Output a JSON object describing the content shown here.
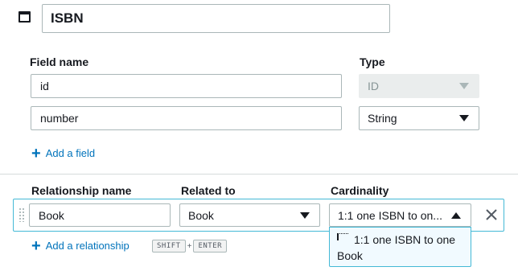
{
  "model": {
    "name": "ISBN",
    "icon": "model-icon"
  },
  "fields": {
    "header_name": "Field name",
    "header_type": "Type",
    "rows": [
      {
        "name": "id",
        "type": "ID",
        "disabled": true
      },
      {
        "name": "number",
        "type": "String",
        "disabled": false
      }
    ],
    "add_field_label": "Add a field"
  },
  "relationships": {
    "header_name": "Relationship name",
    "header_related": "Related to",
    "header_cardinality": "Cardinality",
    "rows": [
      {
        "name": "Book",
        "related_to": "Book",
        "cardinality": "1:1 one ISBN to on..."
      }
    ],
    "add_relationship_label": "Add a relationship",
    "shortcut_keys": [
      "SHIFT",
      "+",
      "ENTER"
    ],
    "dropdown_option_line1": "1:1 one ISBN to one",
    "dropdown_option_line2": "Book"
  },
  "colors": {
    "accent": "#0073bb",
    "focus_border": "#44b9d6",
    "text": "#16191f"
  }
}
